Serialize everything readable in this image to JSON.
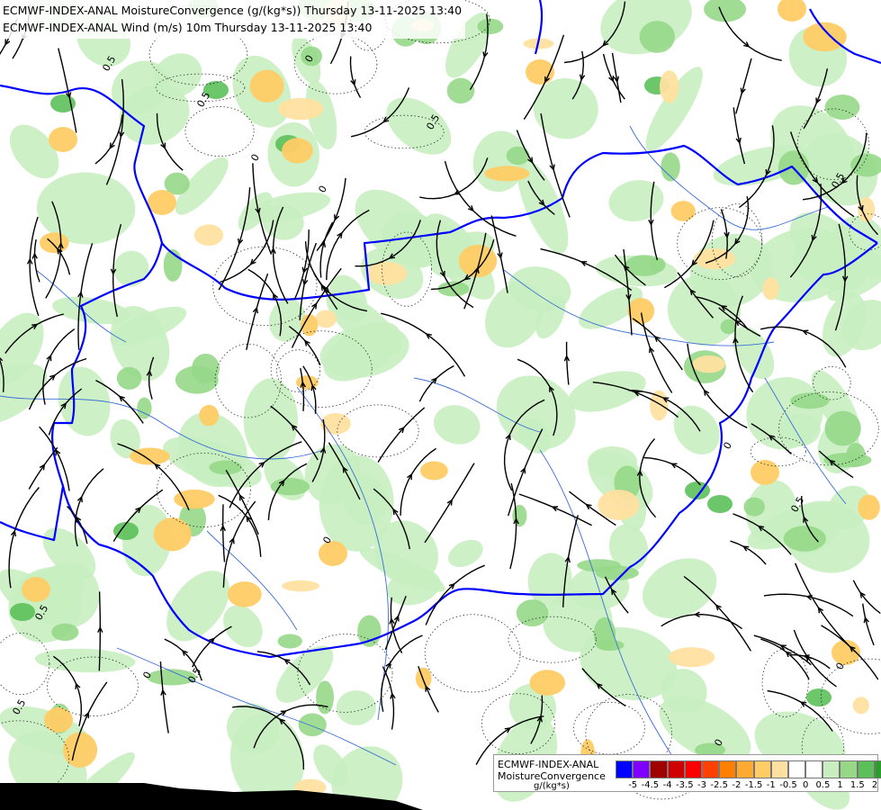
{
  "titles": {
    "line1": "ECMWF-INDEX-ANAL MoistureConvergence (g/(kg*s)) Thursday 13-11-2025 13:40",
    "line2": "ECMWF-INDEX-ANAL Wind (m/s) 10m Thursday 13-11-2025 13:40"
  },
  "legend": {
    "line1": "ECMWF-INDEX-ANAL",
    "line2": "MoistureConvergence",
    "unit": "g/(kg*s)",
    "colors": [
      "#0000ff",
      "#8000ff",
      "#a00000",
      "#d00000",
      "#ff0000",
      "#ff4000",
      "#ff8000",
      "#ffaa33",
      "#ffcc66",
      "#ffe0a0",
      "#ffffff",
      "#ffffff",
      "#c8eec0",
      "#96d888",
      "#5cc05a",
      "#2aa02a",
      "#008000"
    ],
    "ticks": [
      "-5",
      "-4.5",
      "-4",
      "-3.5",
      "-3",
      "-2.5",
      "-2",
      "-1.5",
      "-1",
      "-0.5",
      "0",
      "0.5",
      "1",
      "1.5",
      "2"
    ]
  },
  "contour_labels": [
    "0.5",
    "0",
    "0.5",
    "0",
    "0.5",
    "0",
    "0.5",
    "0",
    "0.5",
    "0",
    "0.5",
    "0",
    "0.5",
    "0",
    "0.5",
    "0"
  ],
  "colors": {
    "border": "#0000ff",
    "river": "#3c6fd8",
    "streamline": "#000000",
    "green_light": "#c8eec0",
    "green_mid": "#96d888",
    "green_dark": "#5cc05a",
    "orange_light": "#ffe0a0",
    "orange_mid": "#ffcc66"
  }
}
